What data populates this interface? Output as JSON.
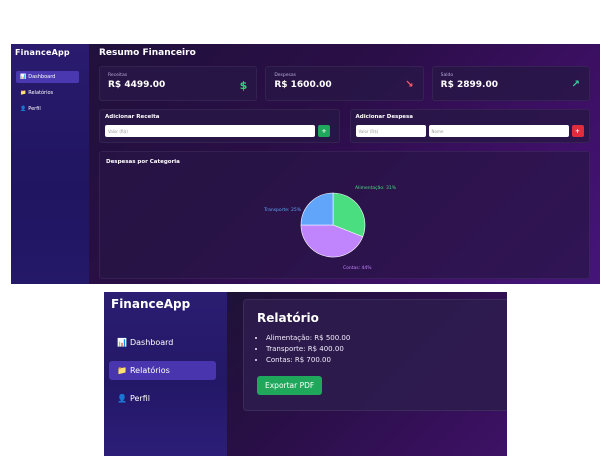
{
  "shot1": {
    "app_title": "FinanceApp",
    "nav": [
      {
        "icon": "📊",
        "icon_name": "chart-icon",
        "label": "Dashboard",
        "active": true
      },
      {
        "icon": "📁",
        "icon_name": "folder-icon",
        "label": "Relatórios",
        "active": false
      },
      {
        "icon": "👤",
        "icon_name": "user-icon",
        "label": "Perfil",
        "active": false
      }
    ],
    "page_title": "Resumo Financeiro",
    "cards": [
      {
        "label": "Receitas",
        "value": "R$ 4499.00",
        "icon": "$",
        "icon_name": "dollar-icon",
        "color": "#35d27a"
      },
      {
        "label": "Despesas",
        "value": "R$ 1600.00",
        "icon": "↘",
        "icon_name": "trend-down-icon",
        "color": "#ff5d6c"
      },
      {
        "label": "Saldo",
        "value": "R$ 2899.00",
        "icon": "↗",
        "icon_name": "trend-up-icon",
        "color": "#36d6a0"
      }
    ],
    "add_income": {
      "title": "Adicionar Receita",
      "value_placeholder": "Valor (R$)",
      "button": "+"
    },
    "add_expense": {
      "title": "Adicionar Despesa",
      "value_placeholder": "Valor (R$)",
      "name_placeholder": "Nome",
      "button": "+"
    },
    "chart_title": "Despesas por Categoria"
  },
  "chart_data": {
    "type": "pie",
    "title": "Despesas por Categoria",
    "slices": [
      {
        "label": "Alimentação: 31%",
        "value": 31,
        "color": "#4ade80"
      },
      {
        "label": "Contas: 44%",
        "value": 44,
        "color": "#c084fc"
      },
      {
        "label": "Transporte: 25%",
        "value": 25,
        "color": "#60a5fa"
      }
    ]
  },
  "shot2": {
    "app_title": "FinanceApp",
    "nav": [
      {
        "icon": "📊",
        "icon_name": "chart-icon",
        "label": "Dashboard",
        "active": false
      },
      {
        "icon": "📁",
        "icon_name": "folder-icon",
        "label": "Relatórios",
        "active": true
      },
      {
        "icon": "👤",
        "icon_name": "user-icon",
        "label": "Perfil",
        "active": false
      }
    ],
    "report_title": "Relatório",
    "report_items": [
      "Alimentação: R$ 500.00",
      "Transporte: R$ 400.00",
      "Contas: R$ 700.00"
    ],
    "export_button": "Exportar PDF"
  }
}
